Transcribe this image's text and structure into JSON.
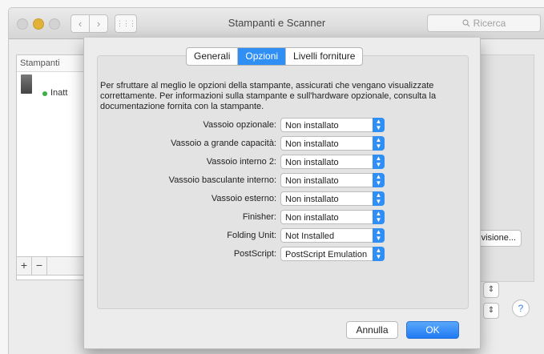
{
  "window": {
    "title": "Stampanti e Scanner",
    "search_placeholder": "Ricerca",
    "nav_back": "‹",
    "nav_forward": "›",
    "grid": "⋮⋮⋮"
  },
  "background": {
    "printers_header": "Stampanti",
    "printer_status": "Inatt",
    "add_label": "+",
    "remove_label": "−",
    "share_button": "divisione...",
    "stepper_glyph": "⇕",
    "help_label": "?"
  },
  "sheet": {
    "tabs": [
      {
        "label": "Generali",
        "active": false
      },
      {
        "label": "Opzioni",
        "active": true
      },
      {
        "label": "Livelli forniture",
        "active": false
      }
    ],
    "description": "Per sfruttare al meglio le opzioni della stampante, assicurati che vengano visualizzate correttamente. Per informazioni sulla stampante e sull'hardware opzionale, consulta la documentazione fornita con la stampante.",
    "options": [
      {
        "label": "Vassoio opzionale:",
        "value": "Non installato"
      },
      {
        "label": "Vassoio a grande capacità:",
        "value": "Non installato"
      },
      {
        "label": "Vassoio interno 2:",
        "value": "Non installato"
      },
      {
        "label": "Vassoio basculante interno:",
        "value": "Non installato"
      },
      {
        "label": "Vassoio esterno:",
        "value": "Non installato"
      },
      {
        "label": "Finisher:",
        "value": "Non installato"
      },
      {
        "label": "Folding Unit:",
        "value": "Not Installed"
      },
      {
        "label": "PostScript:",
        "value": "PostScript Emulation"
      }
    ],
    "cancel_label": "Annulla",
    "ok_label": "OK"
  },
  "colors": {
    "accent": "#2f8ff5"
  }
}
